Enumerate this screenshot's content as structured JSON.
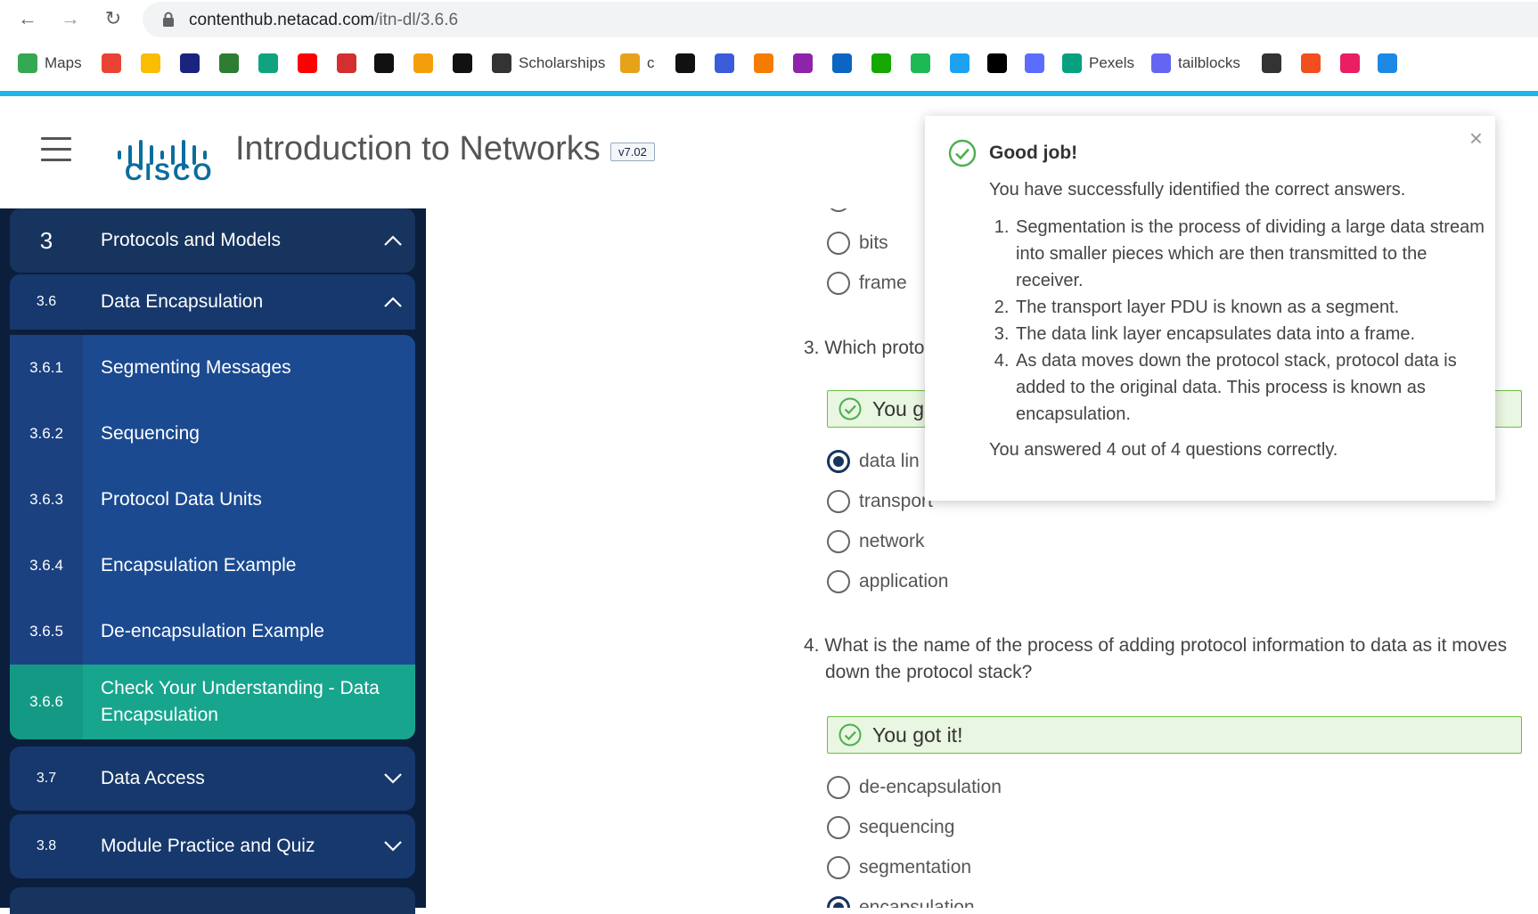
{
  "browser": {
    "url_host": "contenthub.netacad.com",
    "url_path": "/itn-dl/3.6.6",
    "bookmarks": [
      {
        "label": "Maps",
        "icon": "maps-icon",
        "color": "#34a853"
      },
      {
        "label": "",
        "icon": "gmail-icon",
        "color": "#ea4335"
      },
      {
        "label": "",
        "icon": "drive-icon",
        "color": "#fbbc04"
      },
      {
        "label": "",
        "icon": "eye-icon",
        "color": "#1a237e"
      },
      {
        "label": "",
        "icon": "green-one-icon",
        "color": "#2e7d32"
      },
      {
        "label": "",
        "icon": "chatgpt-icon",
        "color": "#10a37f"
      },
      {
        "label": "",
        "icon": "youtube-icon",
        "color": "#ff0000"
      },
      {
        "label": "",
        "icon": "x-red-icon",
        "color": "#d32f2f"
      },
      {
        "label": "",
        "icon": "hackernoon-icon",
        "color": "#111111"
      },
      {
        "label": "",
        "icon": "lightning-icon",
        "color": "#f59e0b"
      },
      {
        "label": "",
        "icon": "github-icon",
        "color": "#111111"
      },
      {
        "label": "Scholarships",
        "icon": "scholarships-icon",
        "color": "#333333"
      },
      {
        "label": "c",
        "icon": "folder-icon",
        "color": "#e6a21a"
      },
      {
        "label": "",
        "icon": "grid-icon",
        "color": "#111111"
      },
      {
        "label": "",
        "icon": "feather-icon",
        "color": "#3b5bdb"
      },
      {
        "label": "",
        "icon": "blogger-icon",
        "color": "#f57c00"
      },
      {
        "label": "",
        "icon": "purple-u-icon",
        "color": "#8e24aa"
      },
      {
        "label": "",
        "icon": "linkedin-icon",
        "color": "#0a66c2"
      },
      {
        "label": "",
        "icon": "upwork-icon",
        "color": "#14a800"
      },
      {
        "label": "",
        "icon": "fi-icon",
        "color": "#1db954"
      },
      {
        "label": "",
        "icon": "bird-icon",
        "color": "#1da1f2"
      },
      {
        "label": "",
        "icon": "triangle-icon",
        "color": "#000000"
      },
      {
        "label": "",
        "icon": "diamond-icon",
        "color": "#5b6cff"
      },
      {
        "label": "Pexels",
        "icon": "pexels-icon",
        "color": "#05a081"
      },
      {
        "label": "tailblocks",
        "icon": "tailblocks-icon",
        "color": "#6366f1"
      },
      {
        "label": "",
        "icon": "cube-icon",
        "color": "#333333"
      },
      {
        "label": "",
        "icon": "figma-icon",
        "color": "#f24e1e"
      },
      {
        "label": "",
        "icon": "gem-icon",
        "color": "#e91e63"
      },
      {
        "label": "",
        "icon": "search-blue-icon",
        "color": "#1e88e5"
      }
    ]
  },
  "header": {
    "logo_text": "CISCO",
    "title": "Introduction to Networks",
    "version": "v7.02"
  },
  "sidebar": {
    "items": [
      {
        "num": "3",
        "label": "Protocols and Models",
        "chevron": "up"
      },
      {
        "num": "3.6",
        "label": "Data Encapsulation",
        "chevron": "up"
      },
      {
        "num": "3.6.1",
        "label": "Segmenting Messages"
      },
      {
        "num": "3.6.2",
        "label": "Sequencing"
      },
      {
        "num": "3.6.3",
        "label": "Protocol Data Units"
      },
      {
        "num": "3.6.4",
        "label": "Encapsulation Example"
      },
      {
        "num": "3.6.5",
        "label": "De-encapsulation Example"
      },
      {
        "num": "3.6.6",
        "label": "Check Your Understanding - Data Encapsulation",
        "active": true
      },
      {
        "num": "3.7",
        "label": "Data Access",
        "chevron": "down"
      },
      {
        "num": "3.8",
        "label": "Module Practice and Quiz",
        "chevron": "down"
      }
    ]
  },
  "content": {
    "q2_options": [
      "bits",
      "frame"
    ],
    "q3": {
      "question": "3. Which proto",
      "feedback": "You g",
      "options": [
        "data lin",
        "transport",
        "network",
        "application"
      ],
      "selected": 0
    },
    "q4": {
      "question": "4. What is the name of the process of adding protocol information to data as it moves down the protocol stack?",
      "feedback": "You got it!",
      "options": [
        "de-encapsulation",
        "sequencing",
        "segmentation",
        "encapsulation"
      ],
      "selected": 3
    }
  },
  "popup": {
    "title": "Good job!",
    "subtitle": "You have successfully identified the correct answers.",
    "points": [
      "Segmentation is the process of dividing a large data stream into smaller pieces which are then transmitted to the receiver.",
      "The transport layer PDU is known as a segment.",
      "The data link layer encapsulates data into a frame.",
      "As data moves down the protocol stack, protocol data is added to the original data. This process is known as encapsulation."
    ],
    "score": "You answered 4 out of 4 questions correctly.",
    "close_symbol": "×"
  }
}
